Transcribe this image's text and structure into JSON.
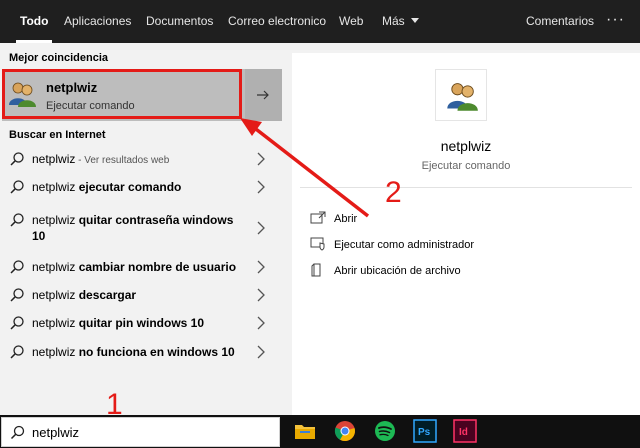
{
  "tabs": [
    {
      "label": "Todo",
      "active": true
    },
    {
      "label": "Aplicaciones"
    },
    {
      "label": "Documentos"
    },
    {
      "label": "Correo electronico"
    },
    {
      "label": "Web"
    },
    {
      "label": "Más"
    },
    {
      "label": "Comentarios"
    }
  ],
  "more_label": "···",
  "left": {
    "best_match_heading": "Mejor coincidencia",
    "best_match": {
      "title": "netplwiz",
      "subtitle": "Ejecutar comando"
    },
    "web_heading": "Buscar en Internet",
    "suggestions": [
      {
        "prefix": "netplwiz",
        "bold": "",
        "hint": " - Ver resultados web"
      },
      {
        "prefix": "netplwiz ",
        "bold": "ejecutar comando",
        "hint": ""
      },
      {
        "prefix": "netplwiz ",
        "bold": "quitar contraseña windows 10",
        "hint": ""
      },
      {
        "prefix": "netplwiz ",
        "bold": "cambiar nombre de usuario",
        "hint": ""
      },
      {
        "prefix": "netplwiz ",
        "bold": "descargar",
        "hint": ""
      },
      {
        "prefix": "netplwiz ",
        "bold": "quitar pin windows 10",
        "hint": ""
      },
      {
        "prefix": "netplwiz ",
        "bold": "no funciona en windows 10",
        "hint": ""
      }
    ]
  },
  "preview": {
    "name": "netplwiz",
    "type": "Ejecutar comando",
    "actions": [
      {
        "label": "Abrir",
        "icon": "open-icon"
      },
      {
        "label": "Ejecutar como administrador",
        "icon": "shield-icon"
      },
      {
        "label": "Abrir ubicación de archivo",
        "icon": "file-location-icon"
      }
    ]
  },
  "search": {
    "value": "netplwiz"
  },
  "annotations": {
    "step1": "1",
    "step2": "2"
  },
  "colors": {
    "annotation": "#e41b17",
    "topbar": "#1f1f1f",
    "selected": "#bdbdbd"
  }
}
